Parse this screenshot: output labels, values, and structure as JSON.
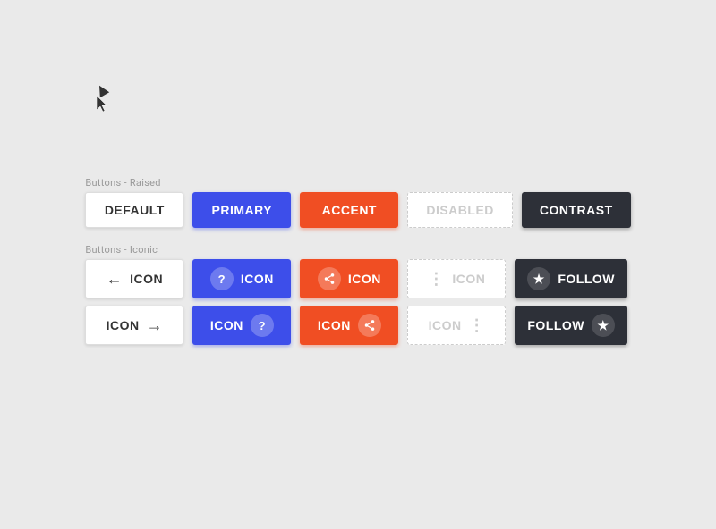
{
  "page": {
    "background": "#eaeaea"
  },
  "sections": {
    "raised": {
      "label": "Buttons - Raised",
      "buttons": [
        {
          "id": "default",
          "label": "DEFAULT",
          "variant": "default"
        },
        {
          "id": "primary",
          "label": "PRIMARY",
          "variant": "primary"
        },
        {
          "id": "accent",
          "label": "ACCENT",
          "variant": "accent"
        },
        {
          "id": "disabled",
          "label": "DISABLED",
          "variant": "disabled"
        },
        {
          "id": "contrast",
          "label": "CONTRAST",
          "variant": "contrast"
        }
      ]
    },
    "iconic": {
      "label": "Buttons - Iconic",
      "rows": [
        {
          "buttons": [
            {
              "id": "icon-default-left",
              "label": "ICON",
              "variant": "default",
              "icon": "arrow-left",
              "iconPosition": "left"
            },
            {
              "id": "icon-primary-q",
              "label": "ICON",
              "variant": "primary",
              "icon": "question",
              "iconPosition": "left"
            },
            {
              "id": "icon-accent-share",
              "label": "ICON",
              "variant": "accent",
              "icon": "share",
              "iconPosition": "left"
            },
            {
              "id": "icon-disabled-dots",
              "label": "ICON",
              "variant": "disabled",
              "icon": "dots",
              "iconPosition": "left"
            },
            {
              "id": "icon-contrast-follow",
              "label": "FOLLOW",
              "variant": "contrast",
              "icon": "star",
              "iconPosition": "left"
            }
          ]
        },
        {
          "buttons": [
            {
              "id": "icon-default-right",
              "label": "ICON",
              "variant": "default",
              "icon": "arrow-right",
              "iconPosition": "right"
            },
            {
              "id": "icon-primary-q2",
              "label": "ICON",
              "variant": "primary",
              "icon": "question",
              "iconPosition": "right"
            },
            {
              "id": "icon-accent-share2",
              "label": "ICON",
              "variant": "accent",
              "icon": "share",
              "iconPosition": "right"
            },
            {
              "id": "icon-disabled-dots2",
              "label": "ICON",
              "variant": "disabled",
              "icon": "dots",
              "iconPosition": "right"
            },
            {
              "id": "icon-contrast-follow2",
              "label": "FOLLOW",
              "variant": "contrast",
              "icon": "star",
              "iconPosition": "right"
            }
          ]
        }
      ]
    }
  }
}
